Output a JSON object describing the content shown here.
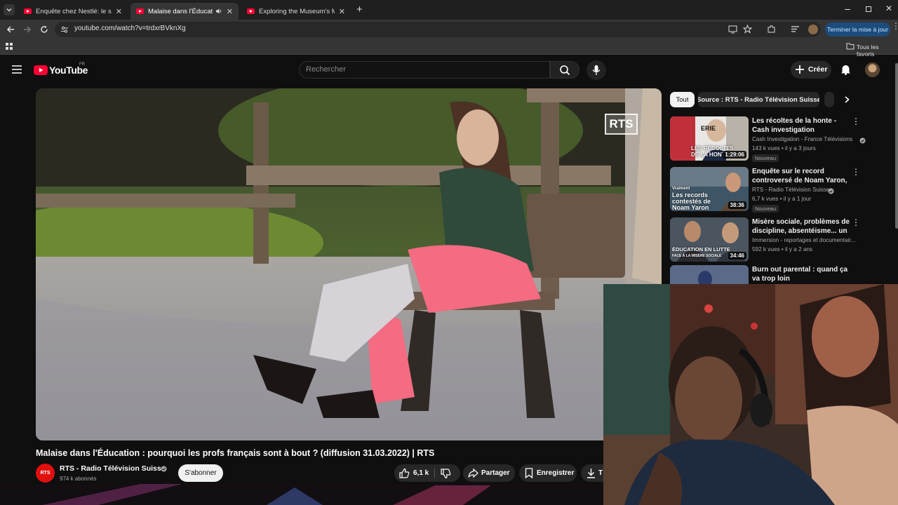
{
  "browser": {
    "tabs": [
      {
        "title": "Enquête chez Nestlé: le scandale",
        "active": false
      },
      {
        "title": "Malaise dans l'Éducation : pourquoi",
        "active": true
      },
      {
        "title": "Exploring the Museum's Most",
        "active": false
      }
    ],
    "url": "youtube.com/watch?v=trdxrBVknXg",
    "update_button": "Terminer la mise à jour",
    "bookmarks_label": "Tous les favoris"
  },
  "youtube": {
    "logo": "YouTube",
    "region": "FR",
    "search_placeholder": "Rechercher",
    "create_label": "Créer"
  },
  "video": {
    "watermark": "RTS",
    "title": "Malaise dans l'Éducation : pourquoi les profs français sont à bout ? (diffusion 31.03.2022) | RTS",
    "channel": {
      "avatar_text": "RTS",
      "name": "RTS - Radio Télévision Suisse",
      "subscribers": "974 k abonnés",
      "subscribe_label": "S'abonner"
    },
    "actions": {
      "likes": "6,1 k",
      "share": "Partager",
      "save": "Enregistrer",
      "download_partial": "T"
    }
  },
  "sidebar": {
    "chips": [
      "Tout",
      "Source : RTS - Radio Télévision Suisse"
    ],
    "recommendations": [
      {
        "title": "Les récoltes de la honte - Cash investigation",
        "channel": "Cash Investigation - France Télévisions",
        "stats": "143 k vues • il y a 3 jours",
        "badge": "Nouveau",
        "duration": "1:29:06",
        "thumb_text": [
          "LES RÉCOLTES",
          "DE LA HONTE"
        ],
        "thumb_corner": "ERIE"
      },
      {
        "title": "Enquête sur le record controversé de Noam Yaron, ...",
        "channel": "RTS - Radio Télévision Suisse",
        "stats": "6,7 k vues • il y a 1 jour",
        "badge": "Nouveau",
        "duration": "38:36",
        "thumb_text": [
          "Les records",
          "contestés de",
          "Noam Yaron"
        ],
        "thumb_corner": "Vraiment"
      },
      {
        "title": "Misère sociale, problèmes de discipline, absentéisme... un ...",
        "channel": "Immersion - reportages et documentair...",
        "stats": "592 k vues • il y a 2 ans",
        "badge": "",
        "duration": "34:46",
        "thumb_text": [
          "ÉDUCATION EN LUTTE",
          "FACE À LA MISÈRE SOCIALE"
        ],
        "thumb_corner": ""
      },
      {
        "title": "Burn out parental : quand ça va trop loin",
        "channel": "",
        "stats": "",
        "badge": "",
        "duration": "",
        "thumb_text": [],
        "thumb_corner": ""
      }
    ]
  },
  "colors": {
    "background": "#0f0f0f",
    "youtube_red": "#ff0033",
    "chip_active": "#f1f1f1",
    "chip": "#272727"
  }
}
